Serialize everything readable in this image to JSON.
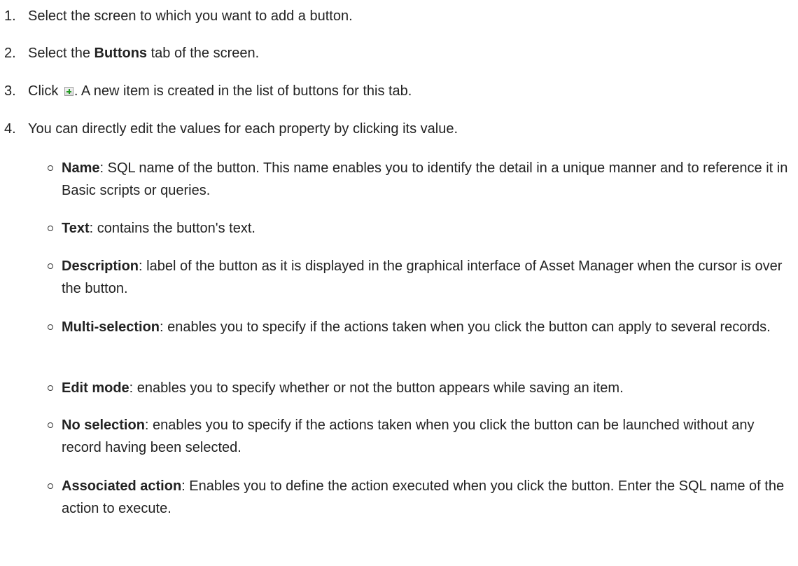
{
  "steps": [
    {
      "num": "1.",
      "text": "Select the screen to which you want to add a button."
    },
    {
      "num": "2.",
      "pre": "Select the ",
      "bold": "Buttons",
      "post": " tab of the screen."
    },
    {
      "num": "3.",
      "pre": "Click ",
      "post": ". A new item is created in the list of buttons for this tab."
    },
    {
      "num": "4.",
      "text": "You can directly edit the values for each property by clicking its value."
    }
  ],
  "properties": [
    {
      "term": "Name",
      "desc": ": SQL name of the button. This name enables you to identify the detail in a unique manner and to reference it in Basic scripts or queries."
    },
    {
      "term": "Text",
      "desc": ": contains the button's text."
    },
    {
      "term": "Description",
      "desc": ": label of the button as it is displayed in the graphical interface of Asset Manager when the cursor is over the button."
    },
    {
      "term": "Multi-selection",
      "desc": ": enables you to specify if the actions taken when you click the button can apply to several records."
    },
    {
      "term": "Edit mode",
      "desc": ": enables you to specify whether or not the button appears while saving an item."
    },
    {
      "term": "No selection",
      "desc": ": enables you to specify if the actions taken when you click the button can be launched without any record having been selected."
    },
    {
      "term": "Associated action",
      "desc": ": Enables you to define the action executed when you click the button. Enter the SQL name of the action to execute."
    }
  ]
}
